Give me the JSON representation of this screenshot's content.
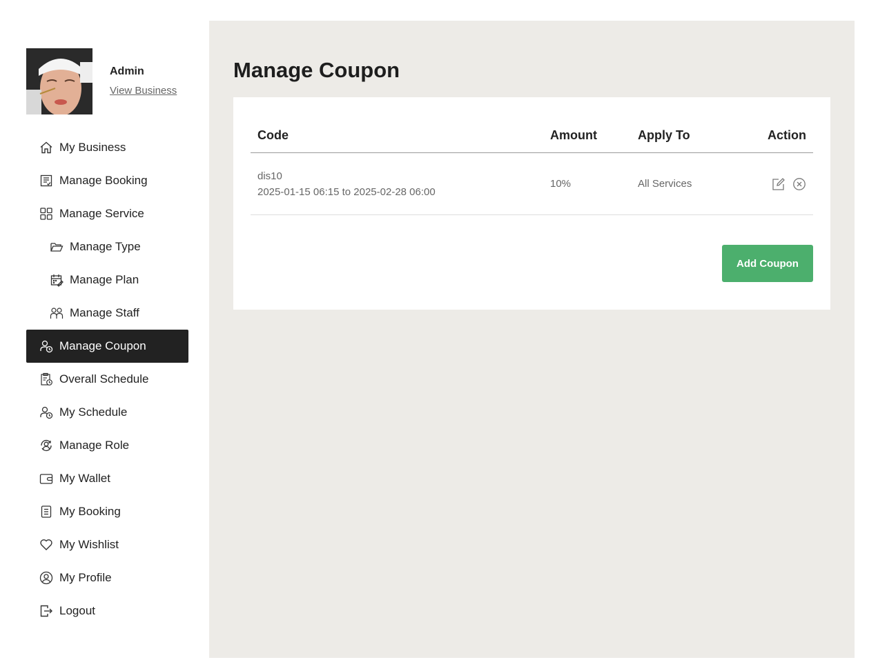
{
  "profile": {
    "name": "Admin",
    "link_label": "View Business"
  },
  "sidebar": {
    "items": [
      {
        "label": "My Business",
        "icon": "home-icon"
      },
      {
        "label": "Manage Booking",
        "icon": "booking-list-icon"
      },
      {
        "label": "Manage Service",
        "icon": "grid-icon"
      },
      {
        "label": "Manage Type",
        "icon": "folder-icon"
      },
      {
        "label": "Manage Plan",
        "icon": "calendar-edit-icon"
      },
      {
        "label": "Manage Staff",
        "icon": "staff-icon"
      },
      {
        "label": "Manage Coupon",
        "icon": "user-clock-icon",
        "active": true
      },
      {
        "label": "Overall Schedule",
        "icon": "clipboard-clock-icon"
      },
      {
        "label": "My Schedule",
        "icon": "user-clock-icon"
      },
      {
        "label": "Manage Role",
        "icon": "role-cycle-icon"
      },
      {
        "label": "My Wallet",
        "icon": "wallet-icon"
      },
      {
        "label": "My Booking",
        "icon": "document-list-icon"
      },
      {
        "label": "My Wishlist",
        "icon": "heart-icon"
      },
      {
        "label": "My Profile",
        "icon": "user-circle-icon"
      },
      {
        "label": "Logout",
        "icon": "logout-icon"
      }
    ]
  },
  "main": {
    "title": "Manage Coupon",
    "table": {
      "headers": {
        "code": "Code",
        "amount": "Amount",
        "apply_to": "Apply To",
        "action": "Action"
      },
      "rows": [
        {
          "code": "dis10",
          "period": "2025-01-15 06:15 to 2025-02-28 06:00",
          "amount": "10%",
          "apply_to": "All Services"
        }
      ]
    },
    "add_button_label": "Add Coupon"
  },
  "colors": {
    "main_bg": "#edebe7",
    "active_nav_bg": "#222222",
    "add_button_bg": "#4caf6d"
  }
}
